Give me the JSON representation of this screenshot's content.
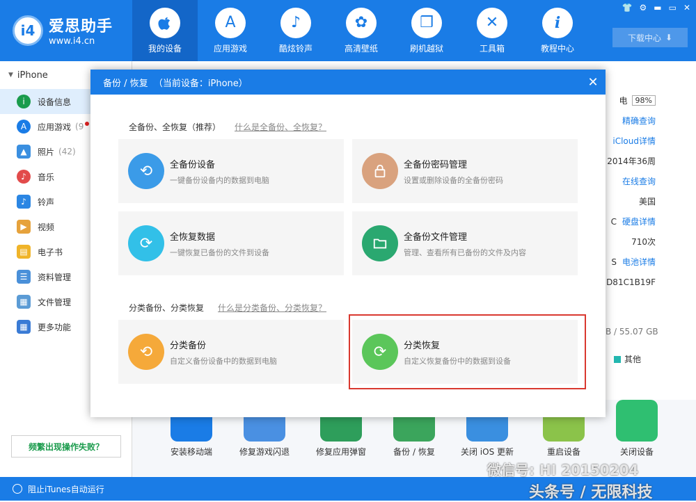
{
  "app": {
    "logo_badge": "i4",
    "logo_name": "爱思助手",
    "logo_url": "www.i4.cn",
    "download_label": "下载中心"
  },
  "nav": [
    {
      "label": "我的设备",
      "icon": "apple-icon",
      "glyph": ""
    },
    {
      "label": "应用游戏",
      "icon": "appstore-icon",
      "glyph": "A"
    },
    {
      "label": "酷炫铃声",
      "icon": "bell-icon",
      "glyph": "♪"
    },
    {
      "label": "高清壁纸",
      "icon": "flower-icon",
      "glyph": "✿"
    },
    {
      "label": "刷机越狱",
      "icon": "box-icon",
      "glyph": "❒"
    },
    {
      "label": "工具箱",
      "icon": "tools-icon",
      "glyph": "✕"
    },
    {
      "label": "教程中心",
      "icon": "info-icon",
      "glyph": "i"
    }
  ],
  "sidebar": {
    "device_name": "iPhone",
    "items": [
      {
        "label": "设备信息",
        "count": "",
        "icon": "info-icon",
        "color": "#1a9b4c",
        "glyph": "i"
      },
      {
        "label": "应用游戏",
        "count": "(9",
        "icon": "appstore-icon",
        "color": "#1a7ce6",
        "glyph": "A"
      },
      {
        "label": "照片",
        "count": "(42)",
        "icon": "photo-icon",
        "color": "#3a8fe0",
        "glyph": "▲"
      },
      {
        "label": "音乐",
        "count": "",
        "icon": "music-icon",
        "color": "#e24b4b",
        "glyph": "♪"
      },
      {
        "label": "铃声",
        "count": "",
        "icon": "bell-icon",
        "color": "#2b86e3",
        "glyph": "♪"
      },
      {
        "label": "视频",
        "count": "",
        "icon": "video-icon",
        "color": "#e6a23c",
        "glyph": "▶"
      },
      {
        "label": "电子书",
        "count": "",
        "icon": "book-icon",
        "color": "#f0b429",
        "glyph": "▤"
      },
      {
        "label": "资料管理",
        "count": "",
        "icon": "contacts-icon",
        "color": "#4a90d9",
        "glyph": "☰"
      },
      {
        "label": "文件管理",
        "count": "",
        "icon": "file-icon",
        "color": "#5b9bd5",
        "glyph": "▦"
      },
      {
        "label": "更多功能",
        "count": "",
        "icon": "grid-icon",
        "color": "#3a7bd5",
        "glyph": "▦"
      }
    ],
    "help_label": "频繁出现操作失败？"
  },
  "bottom_bar": {
    "itunes_label": "阻止iTunes自动运行"
  },
  "background": {
    "rows": [
      {
        "text": "电",
        "badge": "98%",
        "link": ""
      },
      {
        "text": "",
        "badge": "",
        "link": "精确查询"
      },
      {
        "text": "",
        "badge": "",
        "link": "iCloud详情"
      },
      {
        "text": "2014年36周",
        "badge": "",
        "link": ""
      },
      {
        "text": "",
        "badge": "",
        "link": "在线查询"
      },
      {
        "text": "美国",
        "badge": "",
        "link": ""
      },
      {
        "text": "C",
        "badge": "",
        "link": "硬盘详情"
      },
      {
        "text": "710次",
        "badge": "",
        "link": ""
      },
      {
        "text": "S",
        "badge": "",
        "link": "电池详情"
      },
      {
        "text": "D81C1B19F",
        "badge": "",
        "link": ""
      }
    ],
    "storage": "B / 55.07 GB",
    "other_label": "其他",
    "tools": [
      {
        "label": "安装移动端",
        "color": "#1a7ce6"
      },
      {
        "label": "修复游戏闪退",
        "color": "#4a90e2"
      },
      {
        "label": "修复应用弹窗",
        "color": "#2e9e5b"
      },
      {
        "label": "备份 / 恢复",
        "color": "#3ba55c"
      },
      {
        "label": "关闭 iOS 更新",
        "color": "#3a8fe0"
      },
      {
        "label": "重启设备",
        "color": "#8bc34a"
      },
      {
        "label": "关闭设备",
        "color": "#2fbf71"
      }
    ]
  },
  "dialog": {
    "title": "备份 / 恢复  （当前设备：iPhone）",
    "close_glyph": "✕",
    "section1": {
      "title": "全备份、全恢复（推荐）",
      "link": "什么是全备份、全恢复？"
    },
    "section2": {
      "title": "分类备份、分类恢复",
      "link": "什么是分类备份、分类恢复？"
    },
    "cards": [
      {
        "title": "全备份设备",
        "desc": "一键备份设备内的数据到电脑",
        "color": "#3b9be8",
        "icon": "backup-icon",
        "glyph": "⟲"
      },
      {
        "title": "全备份密码管理",
        "desc": "设置或删除设备的全备份密码",
        "color": "#d9a27e",
        "icon": "lock-icon",
        "glyph": "🔒"
      },
      {
        "title": "全恢复数据",
        "desc": "一键恢复已备份的文件到设备",
        "color": "#32c0e8",
        "icon": "restore-icon",
        "glyph": "⟳"
      },
      {
        "title": "全备份文件管理",
        "desc": "管理、查看所有已备份的文件及内容",
        "color": "#2aa870",
        "icon": "folder-icon",
        "glyph": "▭"
      },
      {
        "title": "分类备份",
        "desc": "自定义备份设备中的数据到电脑",
        "color": "#f5a93a",
        "icon": "category-backup-icon",
        "glyph": "⟲"
      },
      {
        "title": "分类恢复",
        "desc": "自定义恢复备份中的数据到设备",
        "color": "#5bc65a",
        "icon": "category-restore-icon",
        "glyph": "⟳"
      }
    ]
  },
  "watermark": {
    "line1": "微信号: HI 20150204",
    "line2": "头条号 / 无限科技"
  }
}
